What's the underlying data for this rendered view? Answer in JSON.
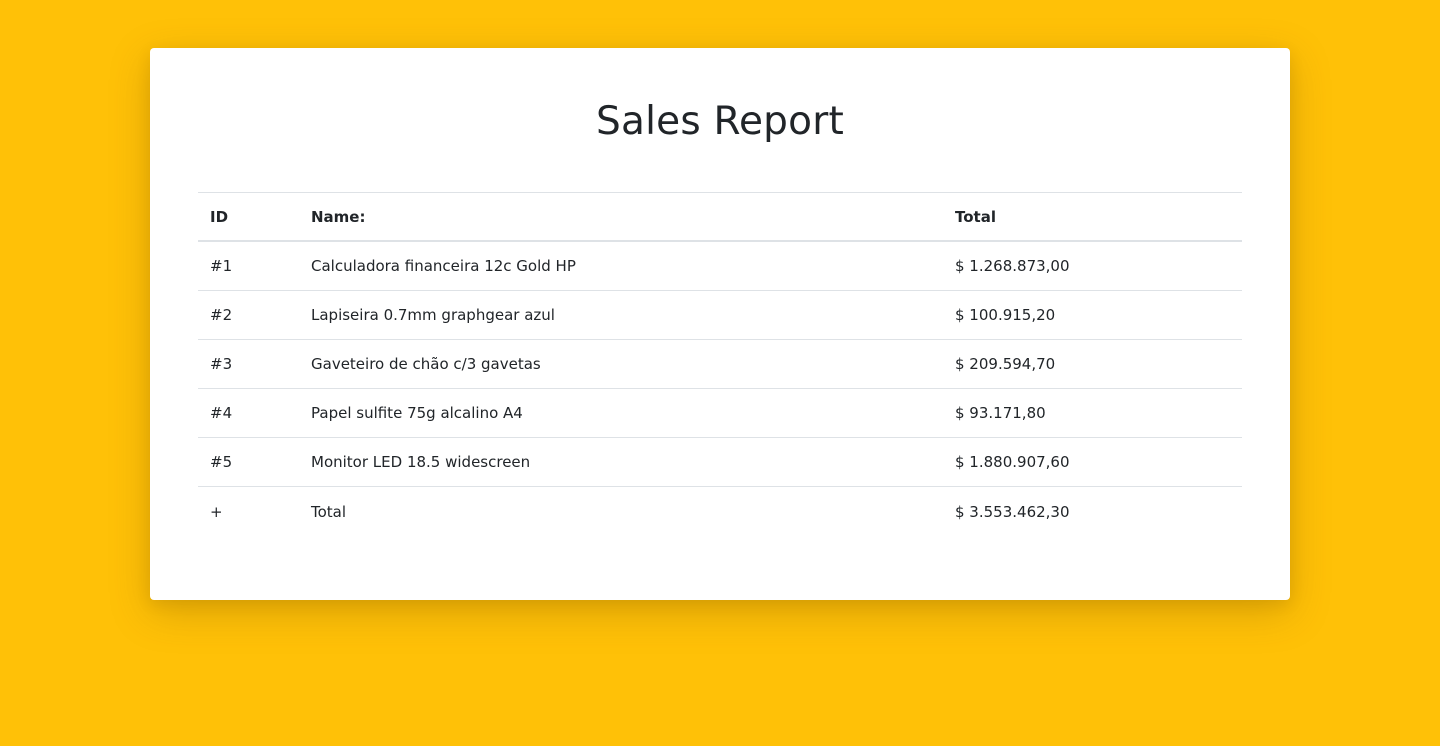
{
  "report": {
    "title": "Sales Report",
    "columns": {
      "id": "ID",
      "name": "Name:",
      "total": "Total"
    },
    "rows": [
      {
        "id": "#1",
        "name": "Calculadora financeira 12c Gold HP",
        "total": "$ 1.268.873,00"
      },
      {
        "id": "#2",
        "name": "Lapiseira 0.7mm graphgear azul",
        "total": "$ 100.915,20"
      },
      {
        "id": "#3",
        "name": "Gaveteiro de chão c/3 gavetas",
        "total": "$ 209.594,70"
      },
      {
        "id": "#4",
        "name": "Papel sulfite 75g alcalino A4",
        "total": "$ 93.171,80"
      },
      {
        "id": "#5",
        "name": "Monitor LED 18.5 widescreen",
        "total": "$ 1.880.907,60"
      }
    ],
    "summary": {
      "id": "+",
      "name": "Total",
      "total": "$ 3.553.462,30"
    }
  },
  "colors": {
    "background": "#FFC107",
    "card": "#FFFFFF",
    "text": "#212529",
    "divider": "#DEE2E6"
  }
}
